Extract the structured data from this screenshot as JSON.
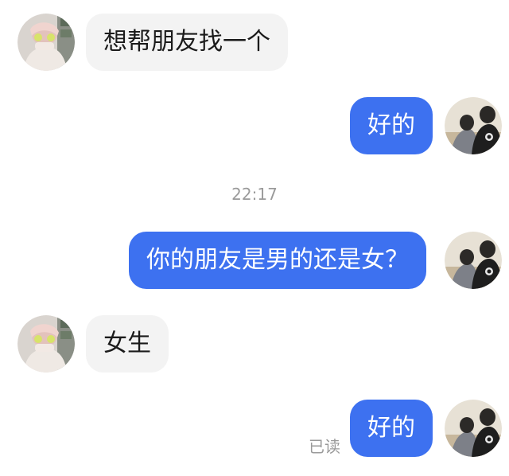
{
  "conversation": {
    "messages": [
      {
        "sender": "friend",
        "text": "想帮朋友找一个"
      },
      {
        "sender": "me",
        "text": "好的"
      },
      {
        "sender": "me",
        "text": "你的朋友是男的还是女？"
      },
      {
        "sender": "friend",
        "text": "女生"
      },
      {
        "sender": "me",
        "text": "好的"
      }
    ],
    "timestamp": "22:17",
    "read_status": "已读"
  },
  "colors": {
    "outgoing_bubble": "#3d71f0",
    "incoming_bubble": "#f3f3f3",
    "meta_text": "#9a9a9a"
  }
}
